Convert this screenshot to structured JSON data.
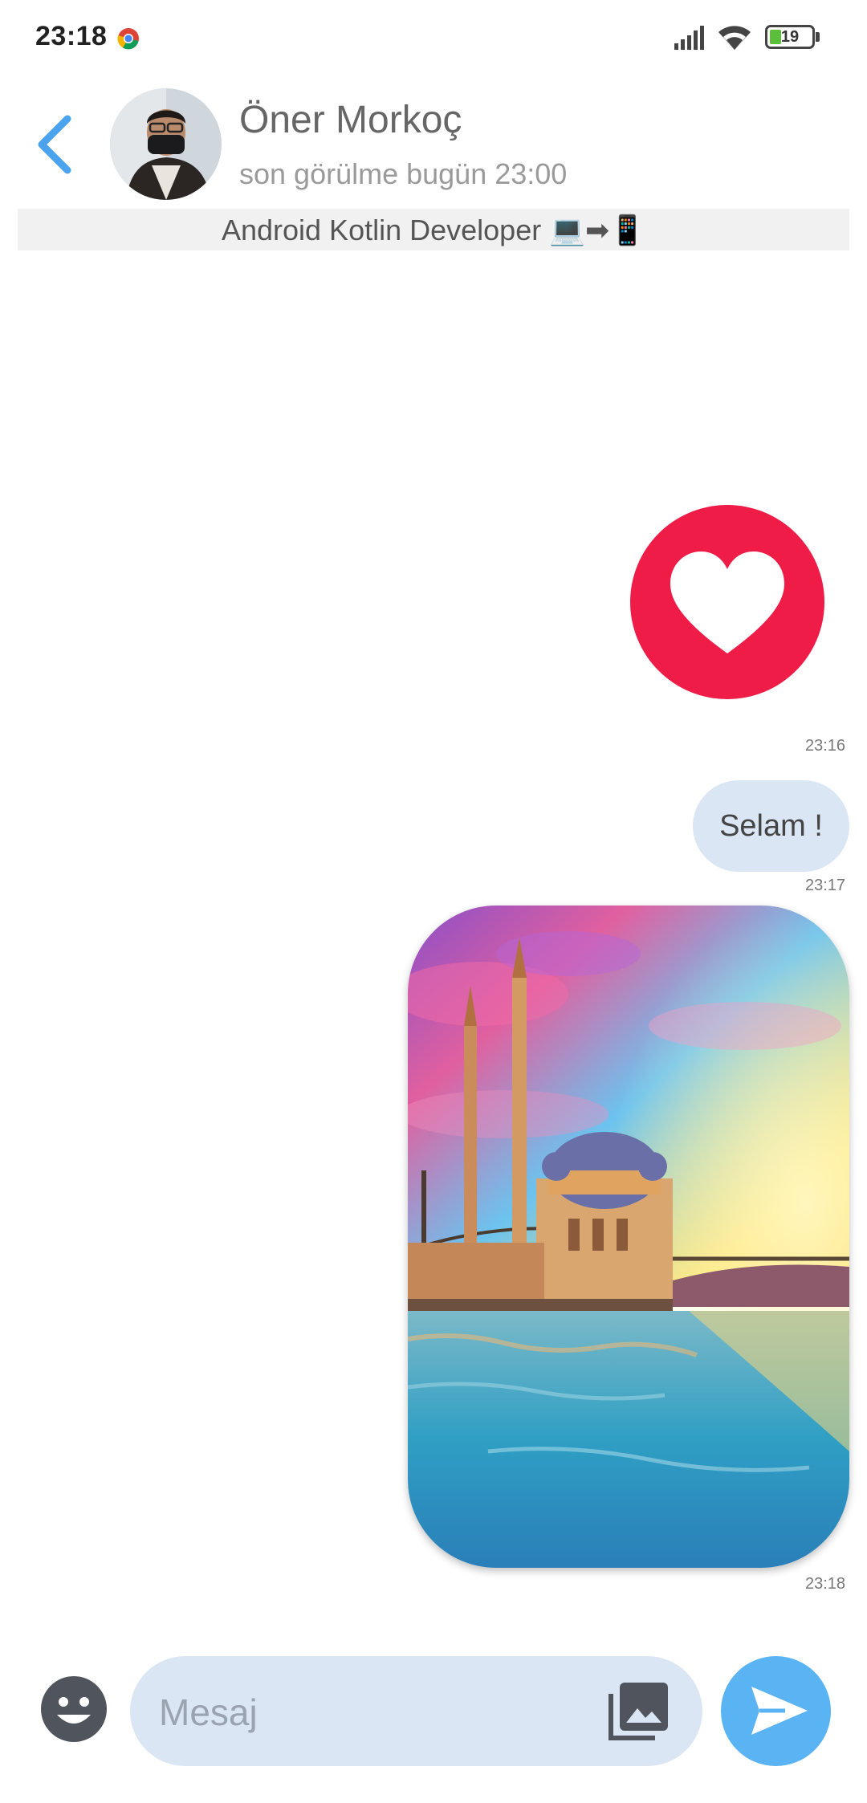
{
  "status_bar": {
    "time": "23:18",
    "battery_level": "19",
    "icons": [
      "chrome-icon",
      "signal-icon",
      "wifi-icon",
      "battery-icon"
    ]
  },
  "header": {
    "contact_name": "Öner Morkoç",
    "last_seen": "son görülme bugün 23:00",
    "bio": "Android Kotlin Developer 💻➡📱",
    "icons": [
      "back-arrow-icon",
      "avatar"
    ]
  },
  "messages": [
    {
      "type": "emoji",
      "icon": "heart-icon",
      "time": "23:16"
    },
    {
      "type": "text",
      "text": "Selam !",
      "time": "23:17"
    },
    {
      "type": "image",
      "icon": "mosque-photo",
      "time": "23:18"
    }
  ],
  "composer": {
    "placeholder": "Mesaj",
    "value": "",
    "icons": [
      "emoji-icon",
      "gallery-icon",
      "send-icon"
    ]
  },
  "colors": {
    "accent_blue": "#5ab3f2",
    "bubble": "#dbe6f5",
    "heart_red": "#ee1c47",
    "bio_bar": "#f1f1f1"
  }
}
